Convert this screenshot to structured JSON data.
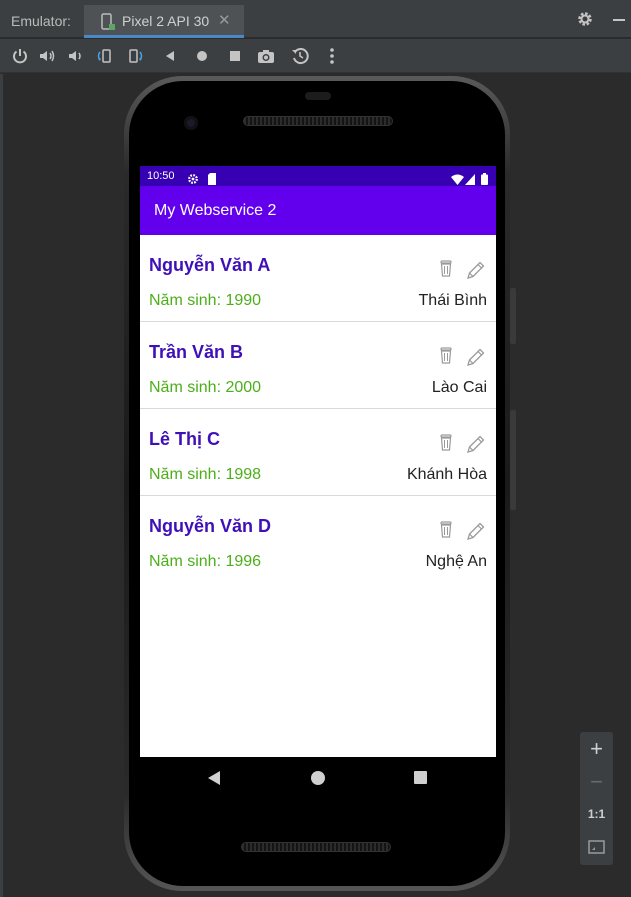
{
  "tool_window": {
    "label": "Emulator:",
    "tab_label": "Pixel 2 API 30",
    "tab_close": "✕"
  },
  "toolbar": {
    "buttons": [
      "power-icon",
      "volume-up-icon",
      "volume-down-icon",
      "rotate-left-icon",
      "rotate-right-icon",
      "back-icon",
      "home-icon",
      "overview-icon",
      "screenshot-icon",
      "snapshot-icon",
      "more-icon"
    ]
  },
  "status_bar": {
    "time": "10:50"
  },
  "app": {
    "title": "My Webservice 2",
    "accent": "#6200ee",
    "status_color": "#3700b3"
  },
  "people": [
    {
      "name": "Nguyễn Văn A",
      "year": "Năm sinh: 1990",
      "place": "Thái Bình"
    },
    {
      "name": "Trần Văn B",
      "year": "Năm sinh: 2000",
      "place": "Lào Cai"
    },
    {
      "name": "Lê Thị C",
      "year": "Năm sinh: 1998",
      "place": "Khánh Hòa"
    },
    {
      "name": "Nguyễn Văn D",
      "year": "Năm sinh: 1996",
      "place": "Nghệ An"
    }
  ],
  "zoom": {
    "zoom_in": "+",
    "zoom_out": "−",
    "actual_size": "1:1"
  }
}
